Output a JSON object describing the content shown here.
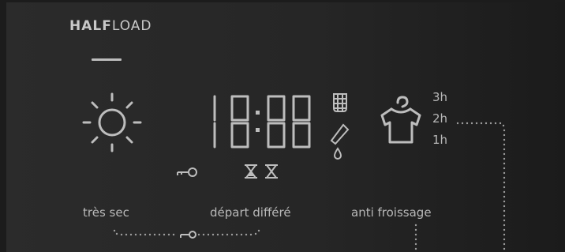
{
  "brand": {
    "bold": "HALF",
    "light": "LOAD"
  },
  "display": {
    "digits": "18:88"
  },
  "hours": [
    "3h",
    "2h",
    "1h"
  ],
  "labels": {
    "dry_level": "très sec",
    "delay_start": "départ différé",
    "anti_crease": "anti froissage"
  },
  "icons": [
    "sun-icon",
    "key-lock-icon",
    "hourglass-icon",
    "filter-icon",
    "water-drain-icon",
    "shirt-hanger-icon"
  ]
}
